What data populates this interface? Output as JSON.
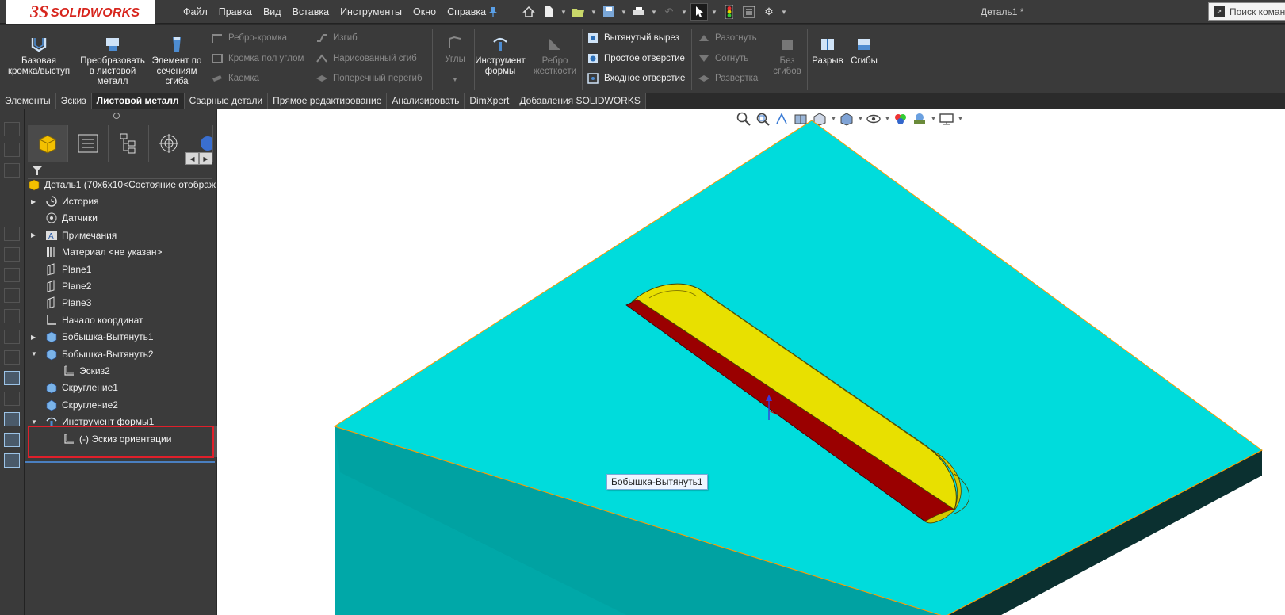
{
  "app": {
    "logo_ds": "3S",
    "logo_brand": "SOLIDWORKS",
    "document_title": "Деталь1 *"
  },
  "menu": [
    "Файл",
    "Правка",
    "Вид",
    "Вставка",
    "Инструменты",
    "Окно",
    "Справка"
  ],
  "search": {
    "placeholder": "Поиск команд"
  },
  "ribbon": {
    "big_buttons": [
      {
        "id": "base-flange",
        "line1": "Базовая",
        "line2": "кромка/выступ",
        "line3": ""
      },
      {
        "id": "convert-sheet",
        "line1": "Преобразовать",
        "line2": "в листовой",
        "line3": "металл"
      },
      {
        "id": "lofted-bend",
        "line1": "Элемент по",
        "line2": "сечениям",
        "line3": "сгиба"
      }
    ],
    "col2": [
      "Ребро-кромка",
      "Кромка пол углом",
      "Каемка"
    ],
    "col3": [
      "Изгиб",
      "Нарисованный сгиб",
      "Поперечный перегиб"
    ],
    "corners": "Углы",
    "forming_tool": {
      "line1": "Инструмент",
      "line2": "формы"
    },
    "gusset": {
      "line1": "Ребро",
      "line2": "жесткости"
    },
    "col_cut": [
      "Вытянутый вырез",
      "Простое отверстие",
      "Входное отверстие"
    ],
    "col_unfold": [
      "Разогнуть",
      "Согнуть",
      "Развертка"
    ],
    "no_bends": {
      "line1": "Без",
      "line2": "сгибов"
    },
    "rip": "Разрыв",
    "bends": "Сгибы"
  },
  "tabs": [
    "Элементы",
    "Эскиз",
    "Листовой металл",
    "Сварные детали",
    "Прямое редактирование",
    "Анализировать",
    "DimXpert",
    "Добавления SOLIDWORKS"
  ],
  "active_tab": "Листовой металл",
  "tree": {
    "root": "Деталь1  (70x6x10<Состояние отображ",
    "items": [
      {
        "label": "История",
        "expandable": true,
        "icon": "history-icon"
      },
      {
        "label": "Датчики",
        "expandable": false,
        "icon": "sensor-icon"
      },
      {
        "label": "Примечания",
        "expandable": true,
        "icon": "annotation-icon"
      },
      {
        "label": "Материал <не указан>",
        "expandable": false,
        "icon": "material-icon"
      },
      {
        "label": "Plane1",
        "expandable": false,
        "icon": "plane-icon"
      },
      {
        "label": "Plane2",
        "expandable": false,
        "icon": "plane-icon"
      },
      {
        "label": "Plane3",
        "expandable": false,
        "icon": "plane-icon"
      },
      {
        "label": "Начало координат",
        "expandable": false,
        "icon": "origin-icon"
      },
      {
        "label": "Бобышка-Вытянуть1",
        "expandable": true,
        "icon": "boss-extrude-icon"
      },
      {
        "label": "Бобышка-Вытянуть2",
        "expandable": true,
        "expanded": true,
        "icon": "boss-extrude-icon"
      },
      {
        "label": "Эскиз2",
        "child": true,
        "icon": "sketch-icon"
      },
      {
        "label": "Скругление1",
        "expandable": false,
        "icon": "fillet-icon"
      },
      {
        "label": "Скругление2",
        "expandable": false,
        "icon": "fillet-icon"
      },
      {
        "label": "Инструмент формы1",
        "expandable": true,
        "expanded": true,
        "icon": "forming-tool-icon",
        "selected": true
      },
      {
        "label": "(-) Эскиз ориентации",
        "child": true,
        "icon": "sketch-icon",
        "selected": true
      }
    ]
  },
  "viewport": {
    "tooltip": "Бобышка-Вытянуть1",
    "colors": {
      "plate_top": "#00dcdc",
      "plate_front": "#009e9e",
      "plate_side": "#0a2f2f",
      "boss_yellow": "#e8e000",
      "boss_red": "#9a0000",
      "edge": "#ff9a00"
    }
  }
}
